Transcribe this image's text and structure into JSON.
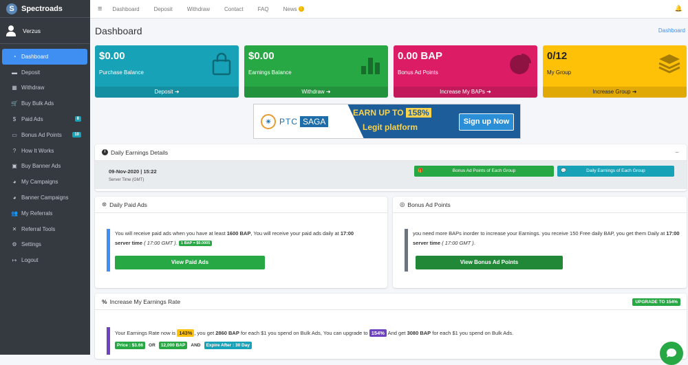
{
  "brand": {
    "name": "Spectroads",
    "logo_letter": "S"
  },
  "user": {
    "name": "Verzus"
  },
  "sidebar": {
    "items": [
      {
        "label": "Dashboard",
        "icon": "dashboard-icon",
        "glyph": "◔",
        "active": true
      },
      {
        "label": "Deposit",
        "icon": "deposit-icon",
        "glyph": "▬"
      },
      {
        "label": "Withdraw",
        "icon": "withdraw-icon",
        "glyph": "▦"
      },
      {
        "label": "Buy Bulk Ads",
        "icon": "cart-icon",
        "glyph": "🛒"
      },
      {
        "label": "Paid Ads",
        "icon": "dollar-icon",
        "glyph": "$",
        "badge": "8"
      },
      {
        "label": "Bonus Ad Points",
        "icon": "bap-icon",
        "glyph": "▭",
        "badge": "10"
      },
      {
        "label": "How It Works",
        "icon": "question-icon",
        "glyph": "?"
      },
      {
        "label": "Buy Banner Ads",
        "icon": "image-icon",
        "glyph": "▣"
      },
      {
        "label": "My Campaigns",
        "icon": "pie-chart-icon",
        "glyph": "◕"
      },
      {
        "label": "Banner Campaigns",
        "icon": "banner-chart-icon",
        "glyph": "◕"
      },
      {
        "label": "My Referrals",
        "icon": "users-icon",
        "glyph": "👥"
      },
      {
        "label": "Referral Tools",
        "icon": "tools-icon",
        "glyph": "✕"
      },
      {
        "label": "Settings",
        "icon": "gear-icon",
        "glyph": "⚙"
      },
      {
        "label": "Logout",
        "icon": "logout-icon",
        "glyph": "↦"
      }
    ]
  },
  "topnav": {
    "menu_glyph": "≡",
    "links": [
      "Dashboard",
      "Deposit",
      "Withdraw",
      "Contact",
      "FAQ",
      "News"
    ],
    "news_badge": "!",
    "bell_glyph": "🔔"
  },
  "page": {
    "title": "Dashboard",
    "breadcrumb": "Dashboard"
  },
  "boxes": [
    {
      "value": "$0.00",
      "label": "Purchase Balance",
      "footer": "Deposit ➜",
      "color": "#17a2b8"
    },
    {
      "value": "$0.00",
      "label": "Earnings Balance",
      "footer": "Withdraw ➜",
      "color": "#28a745"
    },
    {
      "value": "0.00 BAP",
      "label": "Bonus Ad Points",
      "footer": "Increase My BAPs ➜",
      "color": "#dc1d66"
    },
    {
      "value": "0/12",
      "label": "My Group",
      "footer": "Increase Group ➜",
      "color": "#ffc107"
    }
  ],
  "banner": {
    "logo_text": "PTC",
    "logo_text2": "SAGA",
    "earn_text": "EARN UP TO",
    "earn_pct": "158%",
    "legit": "Legit platform",
    "signup": "Sign up Now"
  },
  "daily": {
    "title": "Daily Earnings Details",
    "collapse": "−",
    "date": "09-Nov-2020 | 15:22",
    "server_time": "Server Time (GMT)",
    "btn_bap": "Bonus Ad Points of Each Group",
    "btn_earn": "Daily Earnings of Each Group"
  },
  "paid_ads": {
    "title": "Daily Paid Ads",
    "t1": "You will receive paid ads when you have at least ",
    "bap": "1600 BAP",
    "t2": ", You will receive your paid ads daily at ",
    "time": "17:00",
    "t3": "server time",
    "t4": "( 17:00 GMT )",
    "t5": ".",
    "pill": "1 BAP = $0.0005",
    "button": "View Paid Ads"
  },
  "bonus": {
    "title": "Bonus Ad Points",
    "t1": "you need more BAPs inorder to increase your Earnings. you receive 150 Free daily BAP, you get them Daily at ",
    "time": "17:00 server time",
    "t2": "( 17:00 GMT )",
    "t3": ".",
    "button": "View Bonus Ad Points"
  },
  "rate": {
    "title": "Increase My Earnings Rate",
    "upgrade": "UPGRADE TO 154%",
    "t1": "Your Earnings Rate now is ",
    "now": "143%",
    "t2": ", you get ",
    "bap1": "2860 BAP",
    "t3": " for each $1 you spend on Bulk Ads, You can upgrade to ",
    "up": "154%",
    "t4": " And get ",
    "bap2": "3080 BAP",
    "t5": " for each $1 you spend on Bulk Ads.",
    "price": "Price : $3.66",
    "or": "OR",
    "bap_price": "12,000 BAP",
    "and": "AND",
    "expire": "Expire After : 30 Day"
  }
}
